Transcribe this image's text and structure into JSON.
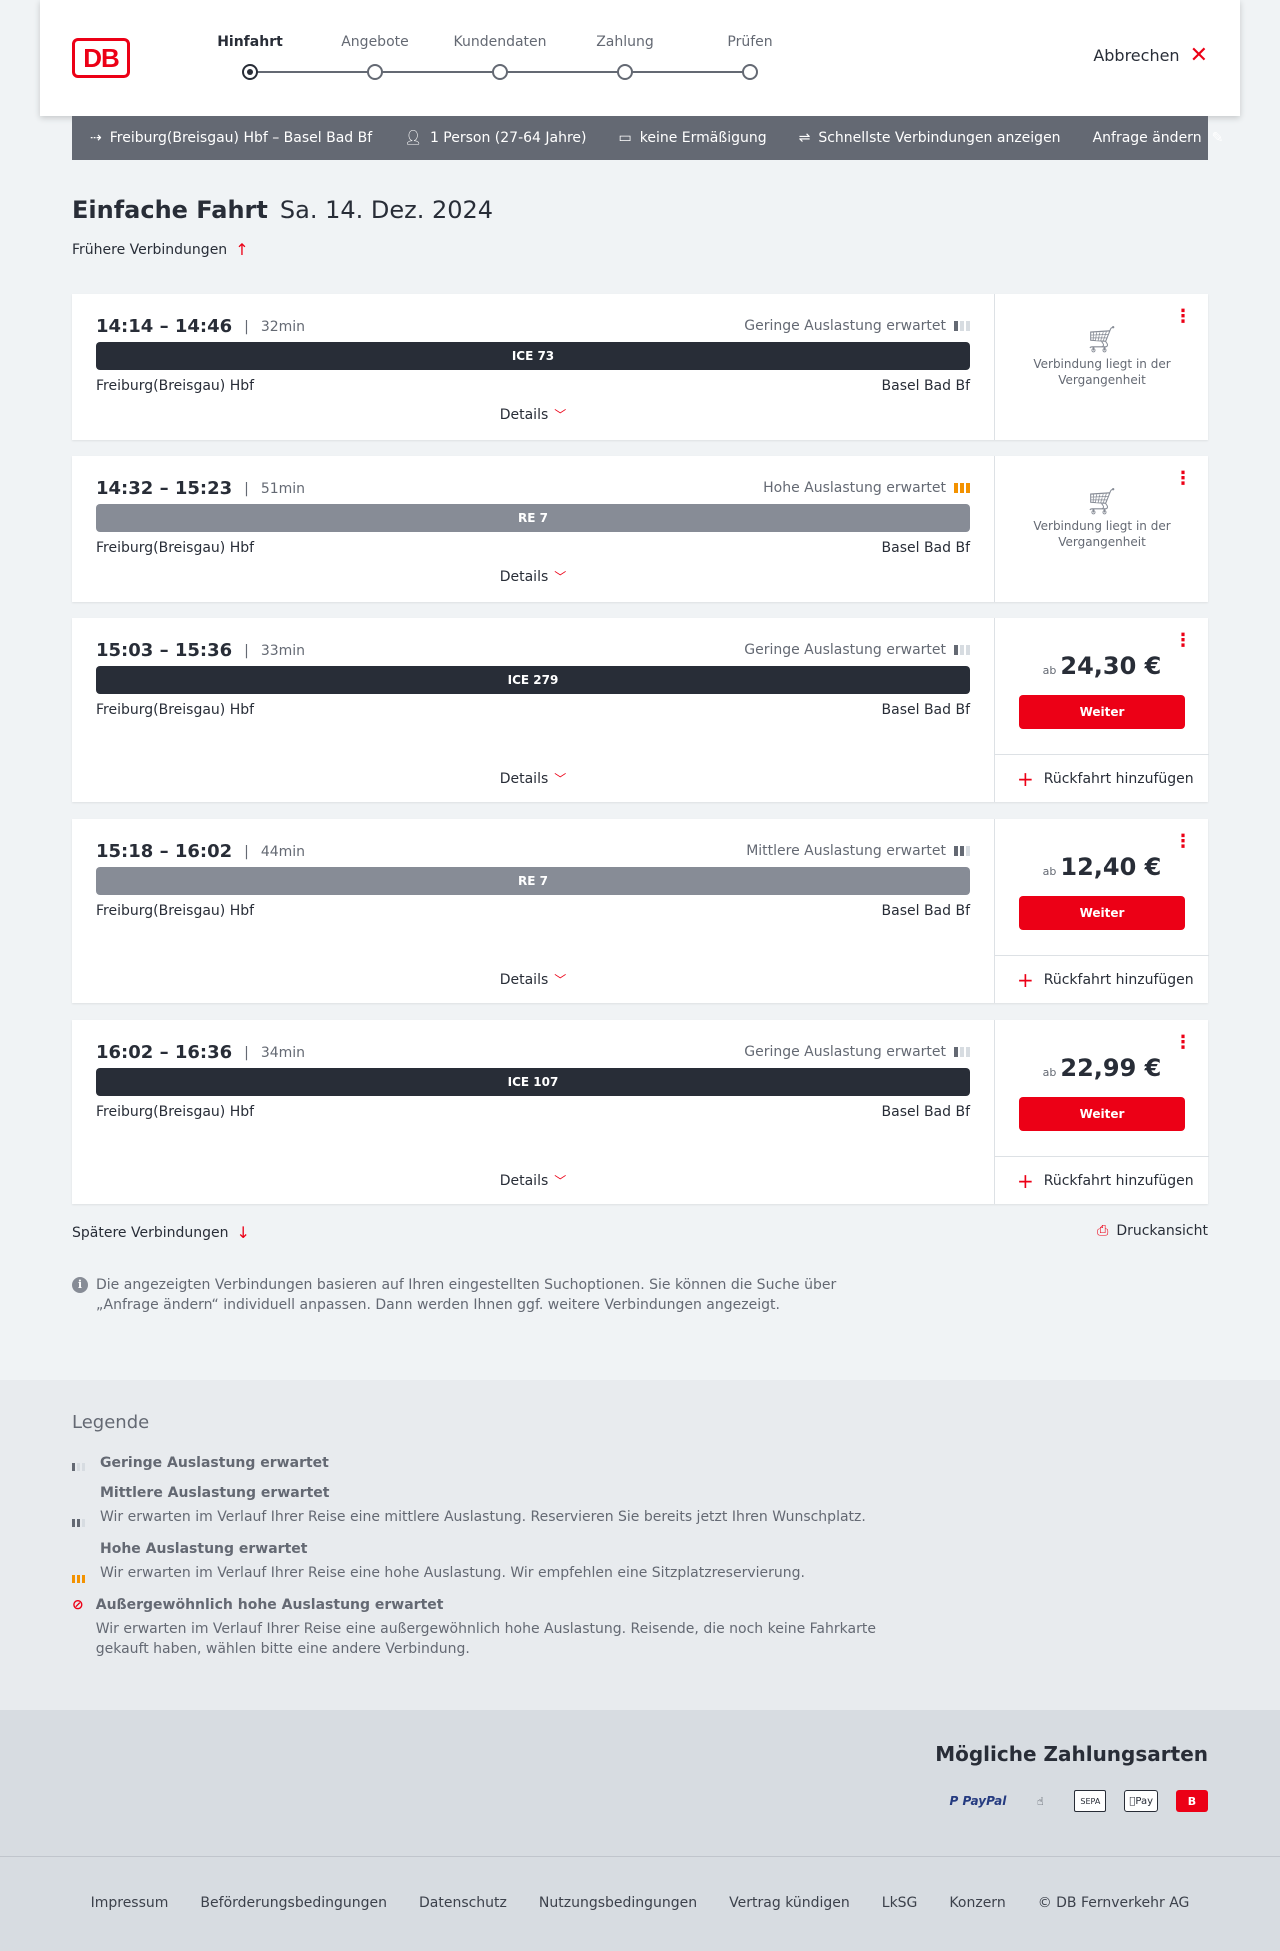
{
  "header": {
    "logo": "DB",
    "steps": [
      "Hinfahrt",
      "Angebote",
      "Kundendaten",
      "Zahlung",
      "Prüfen"
    ],
    "cancel_label": "Abbrechen"
  },
  "searchbar": {
    "route": "Freiburg(Breisgau) Hbf – Basel Bad Bf",
    "persons": "1 Person (27-64 Jahre)",
    "discount": "keine Ermäßigung",
    "fastest": "Schnellste Verbindungen anzeigen",
    "change": "Anfrage ändern"
  },
  "main": {
    "title": "Einfache Fahrt",
    "date": "Sa. 14. Dez. 2024",
    "earlier": "Frühere Verbindungen",
    "later": "Spätere Verbindungen",
    "print": "Druckansicht",
    "info": "Die angezeigten Verbindungen basieren auf Ihren eingestellten Suchoptionen. Sie können die Suche über „Anfrage ändern“ individuell anpassen. Dann werden Ihnen ggf. weitere Verbindungen angezeigt.",
    "details_label": "Details",
    "past_label": "Verbindung liegt in der Vergangenheit",
    "price_prefix": "ab",
    "continue_label": "Weiter",
    "return_label": "Rückfahrt hinzufügen"
  },
  "connections": [
    {
      "times": "14:14 – 14:46",
      "duration": "32min",
      "load": "Geringe Auslastung erwartet",
      "load_level": 1,
      "train": "ICE 73",
      "train_type": "ice",
      "from": "Freiburg(Breisgau) Hbf",
      "to": "Basel Bad Bf",
      "past": true
    },
    {
      "times": "14:32 – 15:23",
      "duration": "51min",
      "load": "Hohe Auslastung erwartet",
      "load_level": 3,
      "train": "RE 7",
      "train_type": "re",
      "from": "Freiburg(Breisgau) Hbf",
      "to": "Basel Bad Bf",
      "past": true
    },
    {
      "times": "15:03 – 15:36",
      "duration": "33min",
      "load": "Geringe Auslastung erwartet",
      "load_level": 1,
      "train": "ICE 279",
      "train_type": "ice",
      "from": "Freiburg(Breisgau) Hbf",
      "to": "Basel Bad Bf",
      "price": "24,30 €"
    },
    {
      "times": "15:18 – 16:02",
      "duration": "44min",
      "load": "Mittlere Auslastung erwartet",
      "load_level": 2,
      "train": "RE 7",
      "train_type": "re",
      "from": "Freiburg(Breisgau) Hbf",
      "to": "Basel Bad Bf",
      "price": "12,40 €"
    },
    {
      "times": "16:02 – 16:36",
      "duration": "34min",
      "load": "Geringe Auslastung erwartet",
      "load_level": 1,
      "train": "ICE 107",
      "train_type": "ice",
      "from": "Freiburg(Breisgau) Hbf",
      "to": "Basel Bad Bf",
      "price": "22,99 €"
    }
  ],
  "legend": {
    "title": "Legende",
    "items": [
      {
        "head": "Geringe Auslastung erwartet",
        "text": ""
      },
      {
        "head": "Mittlere Auslastung erwartet",
        "text": "Wir erwarten im Verlauf Ihrer Reise eine mittlere Auslastung. Reservieren Sie bereits jetzt Ihren Wunschplatz."
      },
      {
        "head": "Hohe Auslastung erwartet",
        "text": "Wir erwarten im Verlauf Ihrer Reise eine hohe Auslastung. Wir empfehlen eine Sitzplatzreservierung."
      },
      {
        "head": "Außergewöhnlich hohe Auslastung erwartet",
        "text": "Wir erwarten im Verlauf Ihrer Reise eine außergewöhnlich hohe Auslastung. Reisende, die noch keine Fahrkarte gekauft haben, wählen bitte eine andere Verbindung."
      }
    ]
  },
  "payment": {
    "title": "Mögliche Zahlungsarten",
    "paypal": "P PayPal",
    "sepa": "SEPA",
    "applepay": "Pay",
    "db": "B"
  },
  "footer": {
    "links": [
      "Impressum",
      "Beförderungsbedingungen",
      "Datenschutz",
      "Nutzungsbedingungen",
      "Vertrag kündigen",
      "LkSG",
      "Konzern",
      "© DB Fernverkehr AG"
    ]
  },
  "colors": {
    "accent": "#ec0016",
    "dark": "#282d37",
    "grey": "#646973",
    "high_load": "#f39200"
  }
}
